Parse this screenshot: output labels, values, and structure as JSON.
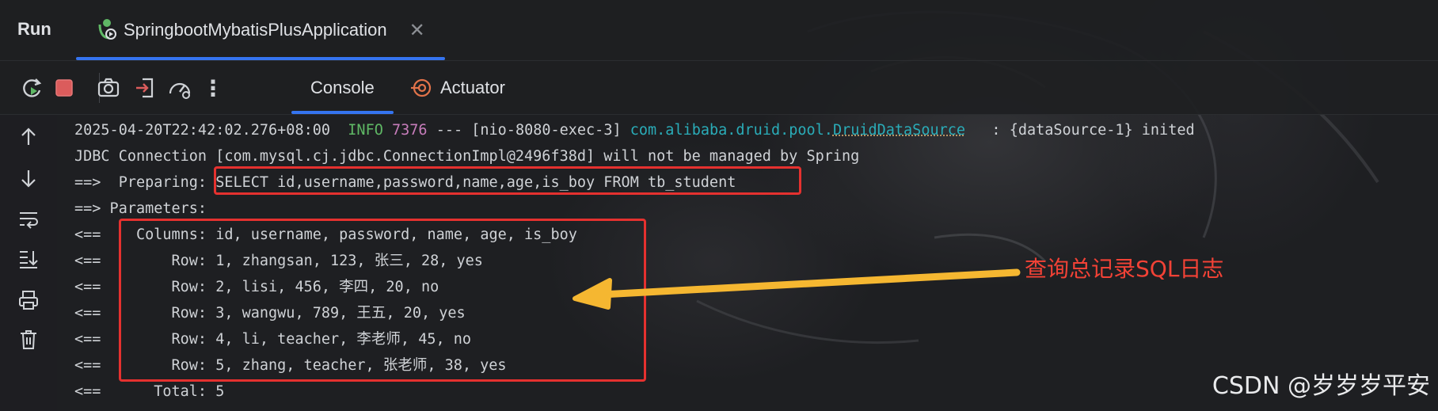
{
  "header": {
    "title": "Run",
    "tab_label": "SpringbootMybatisPlusApplication",
    "tab_close": "✕"
  },
  "toolbar": {
    "tabs": [
      {
        "label": "Console",
        "active": true,
        "icon": "console"
      },
      {
        "label": "Actuator",
        "active": false,
        "icon": "actuator-icon"
      }
    ],
    "more_glyph": "⋮"
  },
  "console": {
    "line0": {
      "timestamp": "2025-04-20T22:42:02.276+08:00",
      "level": "INFO",
      "pid": "7376",
      "thread": " --- [nio-8080-exec-3] ",
      "class_prefix": "com.alibaba.druid.pool.",
      "class_name": "DruidDataSource",
      "message": "   : {dataSource-1} inited"
    },
    "lines": [
      "JDBC Connection [com.mysql.cj.jdbc.ConnectionImpl@2496f38d] will not be managed by Spring",
      "==>  Preparing: SELECT id,username,password,name,age,is_boy FROM tb_student",
      "==> Parameters: ",
      "<==    Columns: id, username, password, name, age, is_boy",
      "<==        Row: 1, zhangsan, 123, 张三, 28, yes",
      "<==        Row: 2, lisi, 456, 李四, 20, no",
      "<==        Row: 3, wangwu, 789, 王五, 20, yes",
      "<==        Row: 4, li, teacher, 李老师, 45, no",
      "<==        Row: 5, zhang, teacher, 张老师, 38, yes",
      "<==      Total: 5"
    ]
  },
  "annotation": "查询总记录SQL日志",
  "watermark": "CSDN @岁岁岁平安",
  "colors": {
    "accent_blue": "#3574f0",
    "annotation_red": "#e5312f",
    "arrow_yellow": "#f5b731",
    "info_green": "#5fb865",
    "class_teal": "#2aacb8"
  }
}
